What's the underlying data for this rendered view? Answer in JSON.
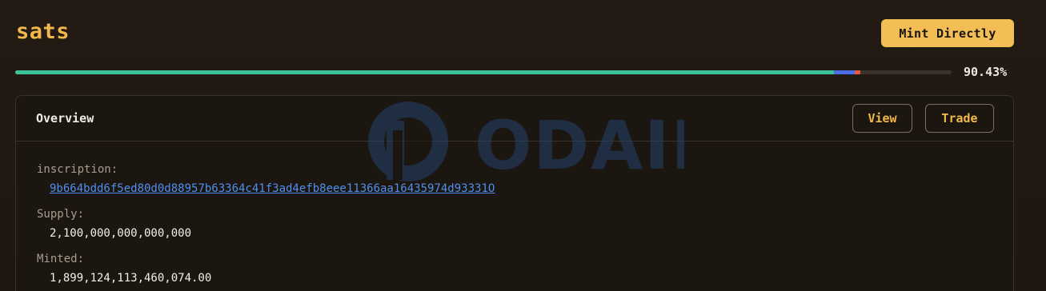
{
  "token": {
    "name": "sats"
  },
  "header": {
    "mint_label": "Mint Directly"
  },
  "progress": {
    "percent_text": "90.43%",
    "minted_fraction": 0.8743,
    "pending_fraction": 0.0222,
    "other_fraction": 0.0065,
    "colors": {
      "minted": "#3cc29a",
      "pending": "#4b6ee8",
      "other": "#e05a3e"
    }
  },
  "overview": {
    "title": "Overview",
    "view_label": "View",
    "trade_label": "Trade",
    "inscription_label": "inscription:",
    "inscription_value": "9b664bdd6f5ed80d0d88957b63364c41f3ad4efb8eee11366aa16435974d93331O",
    "supply_label": "Supply:",
    "supply_value": "2,100,000,000,000,000",
    "minted_label": "Minted:",
    "minted_value": "1,899,124,113,460,074.00"
  },
  "watermark": {
    "text": "ODAILY"
  },
  "colors": {
    "accent": "#f2b84b",
    "link": "#4f8ff0",
    "background": "#1f1812"
  }
}
